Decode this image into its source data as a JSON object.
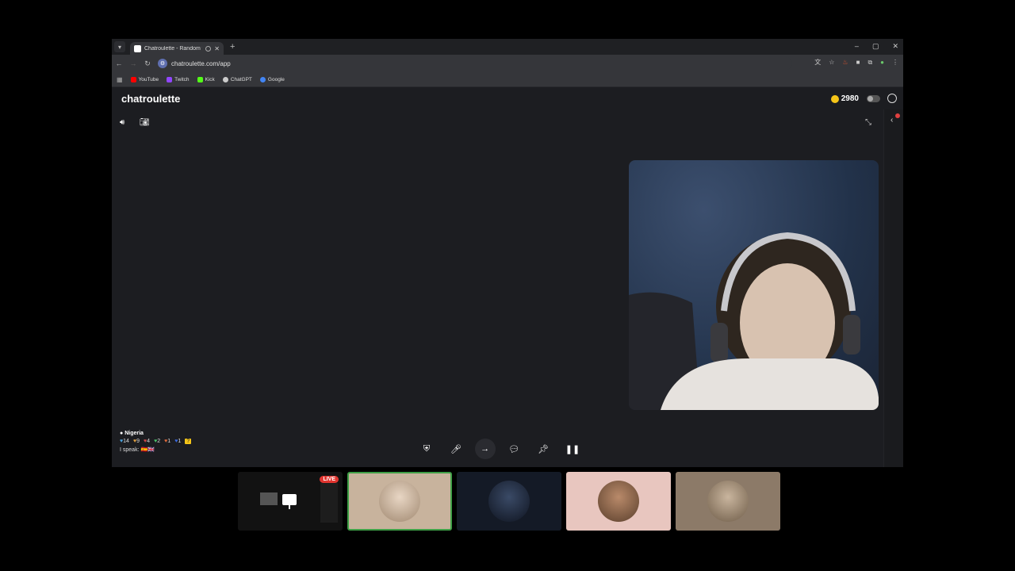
{
  "browser": {
    "tab_title": "Chatroulette - Random vid",
    "tab_close": "✕",
    "new_tab": "+",
    "url": "chatroulette.com/app",
    "window_controls": [
      "–",
      "▢",
      "✕"
    ],
    "bookmarks": [
      {
        "label": "YouTube",
        "color": "#ff0000"
      },
      {
        "label": "Twitch",
        "color": "#9146ff"
      },
      {
        "label": "Kick",
        "color": "#53fc18"
      },
      {
        "label": "ChatGPT",
        "color": "#cccccc"
      },
      {
        "label": "Google",
        "color": "#4285f4"
      }
    ]
  },
  "app": {
    "logo": "chatroulette",
    "coins": "2980",
    "coin_color": "#f5c518"
  },
  "partner": {
    "country": "Nigeria",
    "stats": [
      "14",
      "9",
      "4",
      "2",
      "1",
      "1"
    ],
    "speak_label": "I speak:"
  },
  "thumbnails": {
    "live_label": "LIVE",
    "selected_border": "#3fa047"
  }
}
